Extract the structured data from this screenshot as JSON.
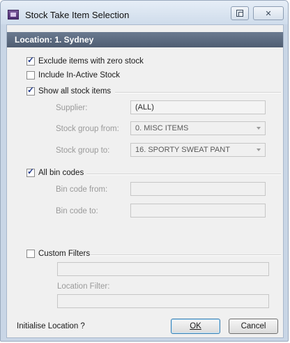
{
  "window": {
    "title": "Stock Take Item Selection",
    "close_glyph": "✕",
    "icons": [
      "app-icon",
      "restore-icon",
      "close-icon"
    ]
  },
  "location_header": "Location: 1. Sydney",
  "options": {
    "exclude_zero": {
      "label": "Exclude items with zero stock",
      "checked": true
    },
    "include_inactive": {
      "label": "Include In-Active Stock",
      "checked": false
    },
    "show_all_stock": {
      "label": "Show all stock items",
      "checked": true
    },
    "all_bin_codes": {
      "label": "All bin codes",
      "checked": true
    },
    "custom_filters": {
      "label": "Custom Filters",
      "checked": false
    }
  },
  "stock_section": {
    "supplier_label": "Supplier:",
    "supplier_value": "(ALL)",
    "group_from_label": "Stock group from:",
    "group_from_value": "0. MISC ITEMS",
    "group_to_label": "Stock group to:",
    "group_to_value": "16. SPORTY SWEAT PANT"
  },
  "bin_section": {
    "from_label": "Bin code from:",
    "from_value": "",
    "to_label": "Bin code to:",
    "to_value": ""
  },
  "custom_section": {
    "filter_value": "",
    "location_filter_label": "Location Filter:",
    "location_filter_value": ""
  },
  "footer": {
    "initialise_label": "Initialise Location ?",
    "ok_label": "OK",
    "cancel_label": "Cancel"
  }
}
